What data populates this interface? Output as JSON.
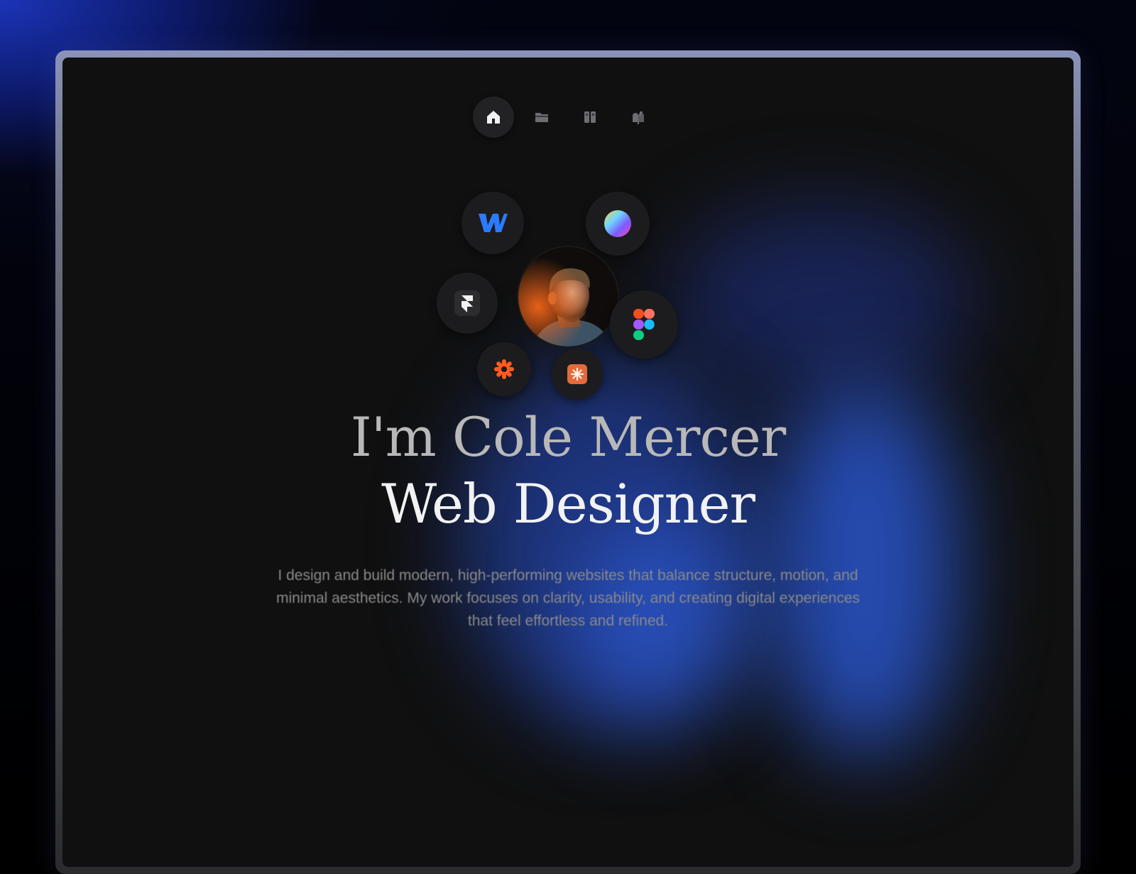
{
  "hero": {
    "name_line": "I'm Cole Mercer",
    "role_line": "Web Designer",
    "description": "I design and build modern, high-performing websites that balance structure, motion, and minimal aesthetics. My work focuses on clarity, usability, and creating digital experiences that feel effortless and refined."
  },
  "nav": {
    "items": [
      {
        "icon": "home-icon",
        "active": true
      },
      {
        "icon": "folder-icon",
        "active": false
      },
      {
        "icon": "book-icon",
        "active": false
      },
      {
        "icon": "mailbox-icon",
        "active": false
      }
    ]
  },
  "tool_icons": [
    "webflow-icon",
    "gradient-sphere-icon",
    "framer-icon",
    "figma-icon",
    "zapier-icon",
    "spark-app-icon"
  ],
  "colors": {
    "background": "#101010",
    "accent_blue": "#2d5fe6",
    "title_muted": "#b8b8b8",
    "title_bright": "#f2f2f2",
    "body_text": "#8a8a8a"
  }
}
